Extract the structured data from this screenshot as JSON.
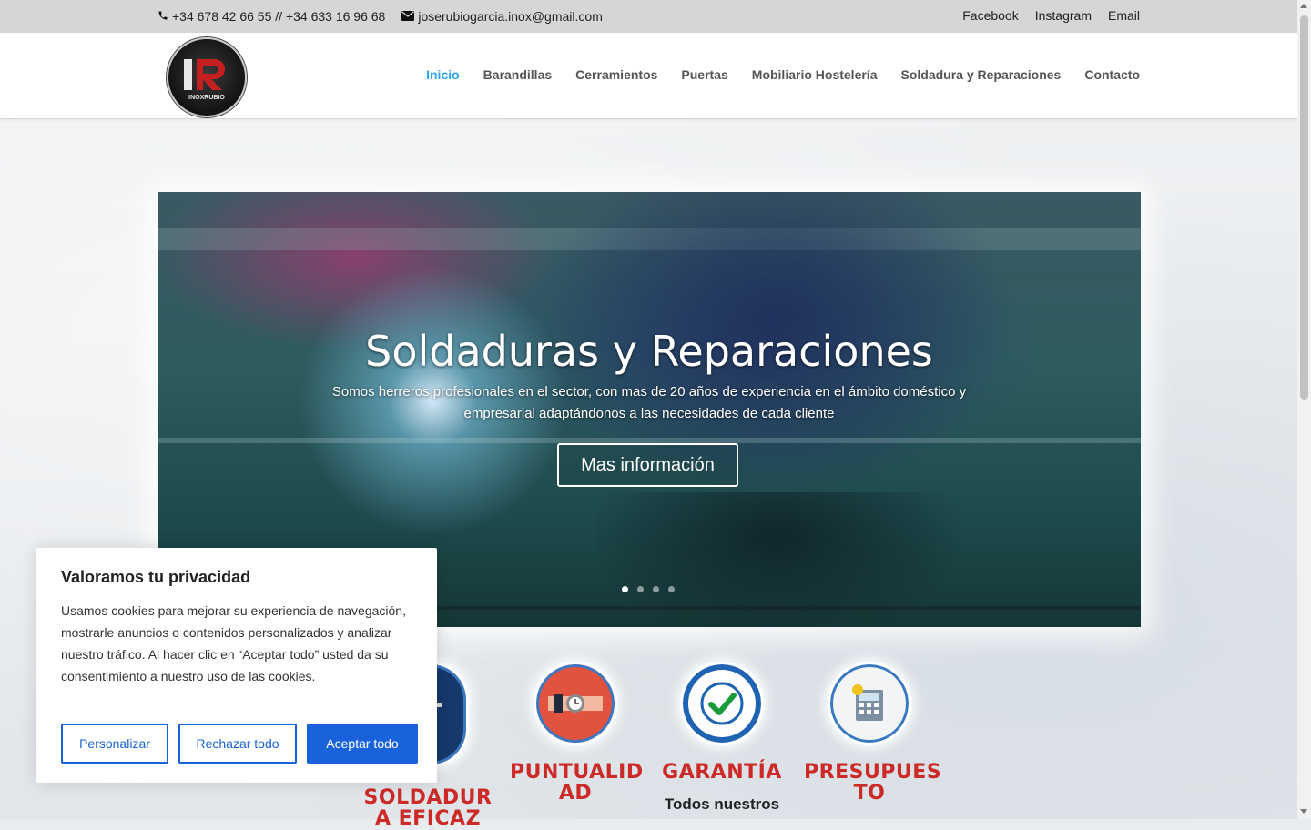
{
  "topbar": {
    "phone": "+34 678 42 66 55 // +34 633 16 96 68",
    "email": "joserubiogarcia.inox@gmail.com",
    "social": [
      "Facebook",
      "Instagram",
      "Email"
    ]
  },
  "logo": {
    "text_big": "IR",
    "text_small": "INOXRUBIO"
  },
  "nav": {
    "items": [
      "Inicio",
      "Barandillas",
      "Cerramientos",
      "Puertas",
      "Mobiliario Hostelería",
      "Soldadura y Reparaciones",
      "Contacto"
    ],
    "active": "Inicio"
  },
  "hero": {
    "title": "Soldaduras y Reparaciones",
    "subtitle": "Somos herreros profesionales en el sector, con mas de 20 años de experiencia en el ámbito doméstico y empresarial adaptándonos a las necesidades de cada cliente",
    "button": "Mas información",
    "slides": 4,
    "active_slide": 1
  },
  "features": [
    {
      "title": "SOLDADURA EFICAZ",
      "icon": "welding-icon"
    },
    {
      "title": "PUNTUALIDAD",
      "icon": "watch-icon"
    },
    {
      "title": "GARANTÍA",
      "icon": "guarantee-check-icon",
      "desc": "Todos nuestros"
    },
    {
      "title": "PRESUPUESTO",
      "icon": "calculator-icon"
    }
  ],
  "cookie": {
    "title": "Valoramos tu privacidad",
    "text": "Usamos cookies para mejorar su experiencia de navegación, mostrarle anuncios o contenidos personalizados y analizar nuestro tráfico. Al hacer clic en “Aceptar todo” usted da su consentimiento a nuestro uso de las cookies.",
    "btn_customize": "Personalizar",
    "btn_reject": "Rechazar todo",
    "btn_accept": "Aceptar todo"
  },
  "colors": {
    "accent": "#2ea3f2",
    "feature_title": "#cc2a27",
    "cookie_button": "#1863dc"
  }
}
